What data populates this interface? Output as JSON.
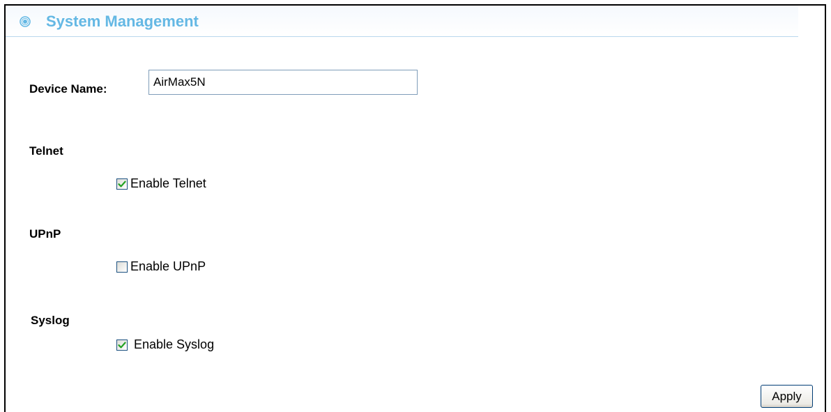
{
  "header": {
    "title": "System Management",
    "accent_color": "#64b8e4",
    "icon": "target-circle-icon"
  },
  "device": {
    "label": "Device Name:",
    "value": "AirMax5N"
  },
  "telnet": {
    "section_title": "Telnet",
    "checkbox_label": "Enable Telnet",
    "checked": true
  },
  "upnp": {
    "section_title": "UPnP",
    "checkbox_label": "Enable UPnP",
    "checked": false
  },
  "syslog": {
    "section_title": "Syslog",
    "checkbox_label": "Enable Syslog",
    "checked": true
  },
  "actions": {
    "apply_label": "Apply"
  }
}
